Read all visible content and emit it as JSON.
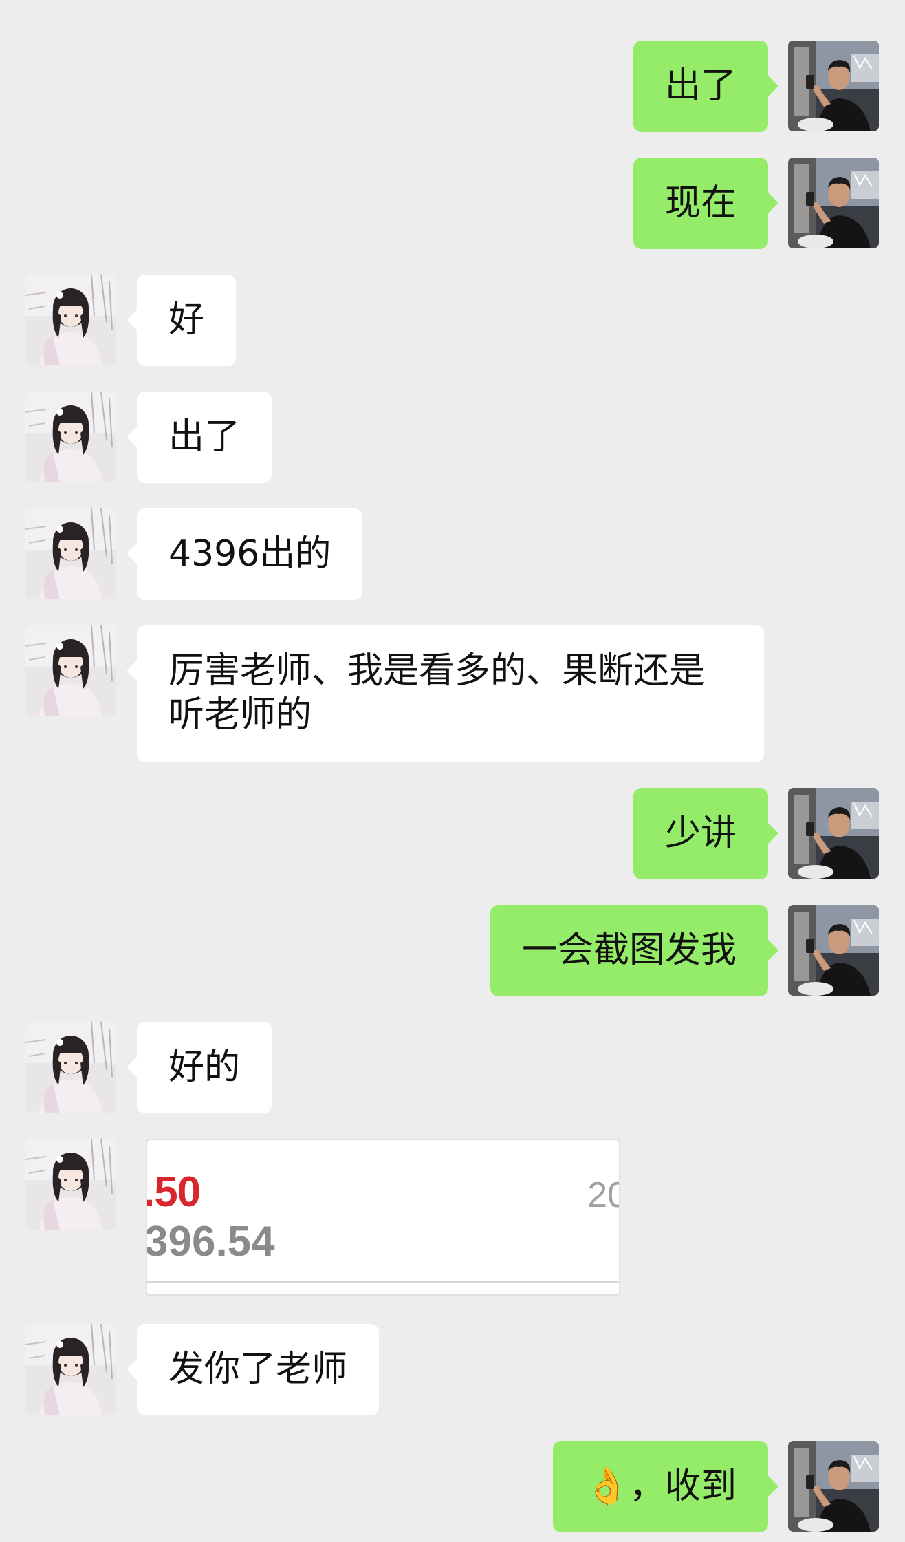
{
  "chat": {
    "messages": [
      {
        "side": "out",
        "text": "出了"
      },
      {
        "side": "out",
        "text": "现在"
      },
      {
        "side": "in",
        "text": "好"
      },
      {
        "side": "in",
        "text": "出了"
      },
      {
        "side": "in",
        "text": "4396出的"
      },
      {
        "side": "in",
        "text": "厉害老师、我是看多的、果断还是听老师的"
      },
      {
        "side": "out",
        "text": "少讲"
      },
      {
        "side": "out",
        "text": "一会截图发我"
      },
      {
        "side": "in",
        "text": "好的"
      },
      {
        "side": "in",
        "type": "image",
        "image_text": {
          "line1": ".50",
          "line2": "396.54",
          "corner": "20"
        }
      },
      {
        "side": "in",
        "text": "发你了老师"
      },
      {
        "side": "out",
        "emoji": "👌",
        "text": "，收到"
      }
    ]
  },
  "colors": {
    "background": "#ededed",
    "incoming_bubble": "#ffffff",
    "outgoing_bubble": "#95ec69",
    "price_red": "#d9262c"
  },
  "icons": {
    "incoming_avatar": "girl-avatar",
    "outgoing_avatar": "man-avatar"
  }
}
